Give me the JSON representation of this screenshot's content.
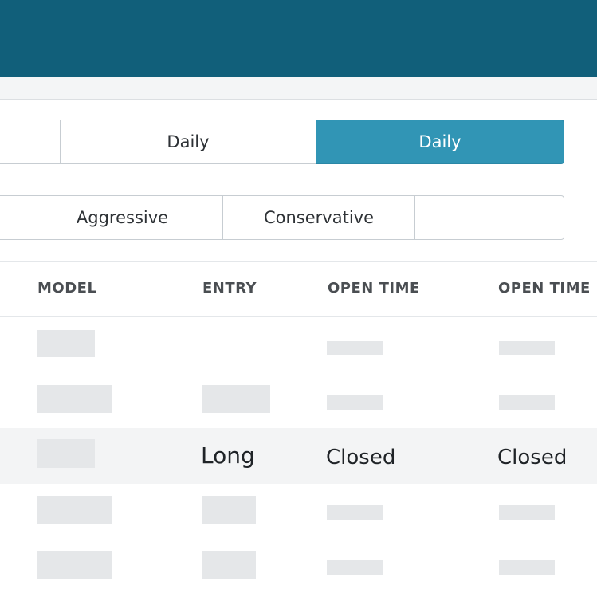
{
  "timeframe_tabs": [
    {
      "label": ""
    },
    {
      "label": "Daily"
    },
    {
      "label": "Daily",
      "active": true
    }
  ],
  "risk_tabs": [
    {
      "label": ""
    },
    {
      "label": "Aggressive"
    },
    {
      "label": "Conservative"
    },
    {
      "label": ""
    }
  ],
  "table": {
    "columns": [
      "MODEL",
      "ENTRY",
      "OPEN TIME",
      "OPEN TIME"
    ],
    "highlighted_row": {
      "entry": "Long",
      "open_time_1": "Closed",
      "open_time_2": "Closed"
    }
  },
  "colors": {
    "header": "#115f7a",
    "active_tab": "#3195b5",
    "placeholder": "#e5e7e9",
    "row_highlight": "#f3f4f5"
  }
}
